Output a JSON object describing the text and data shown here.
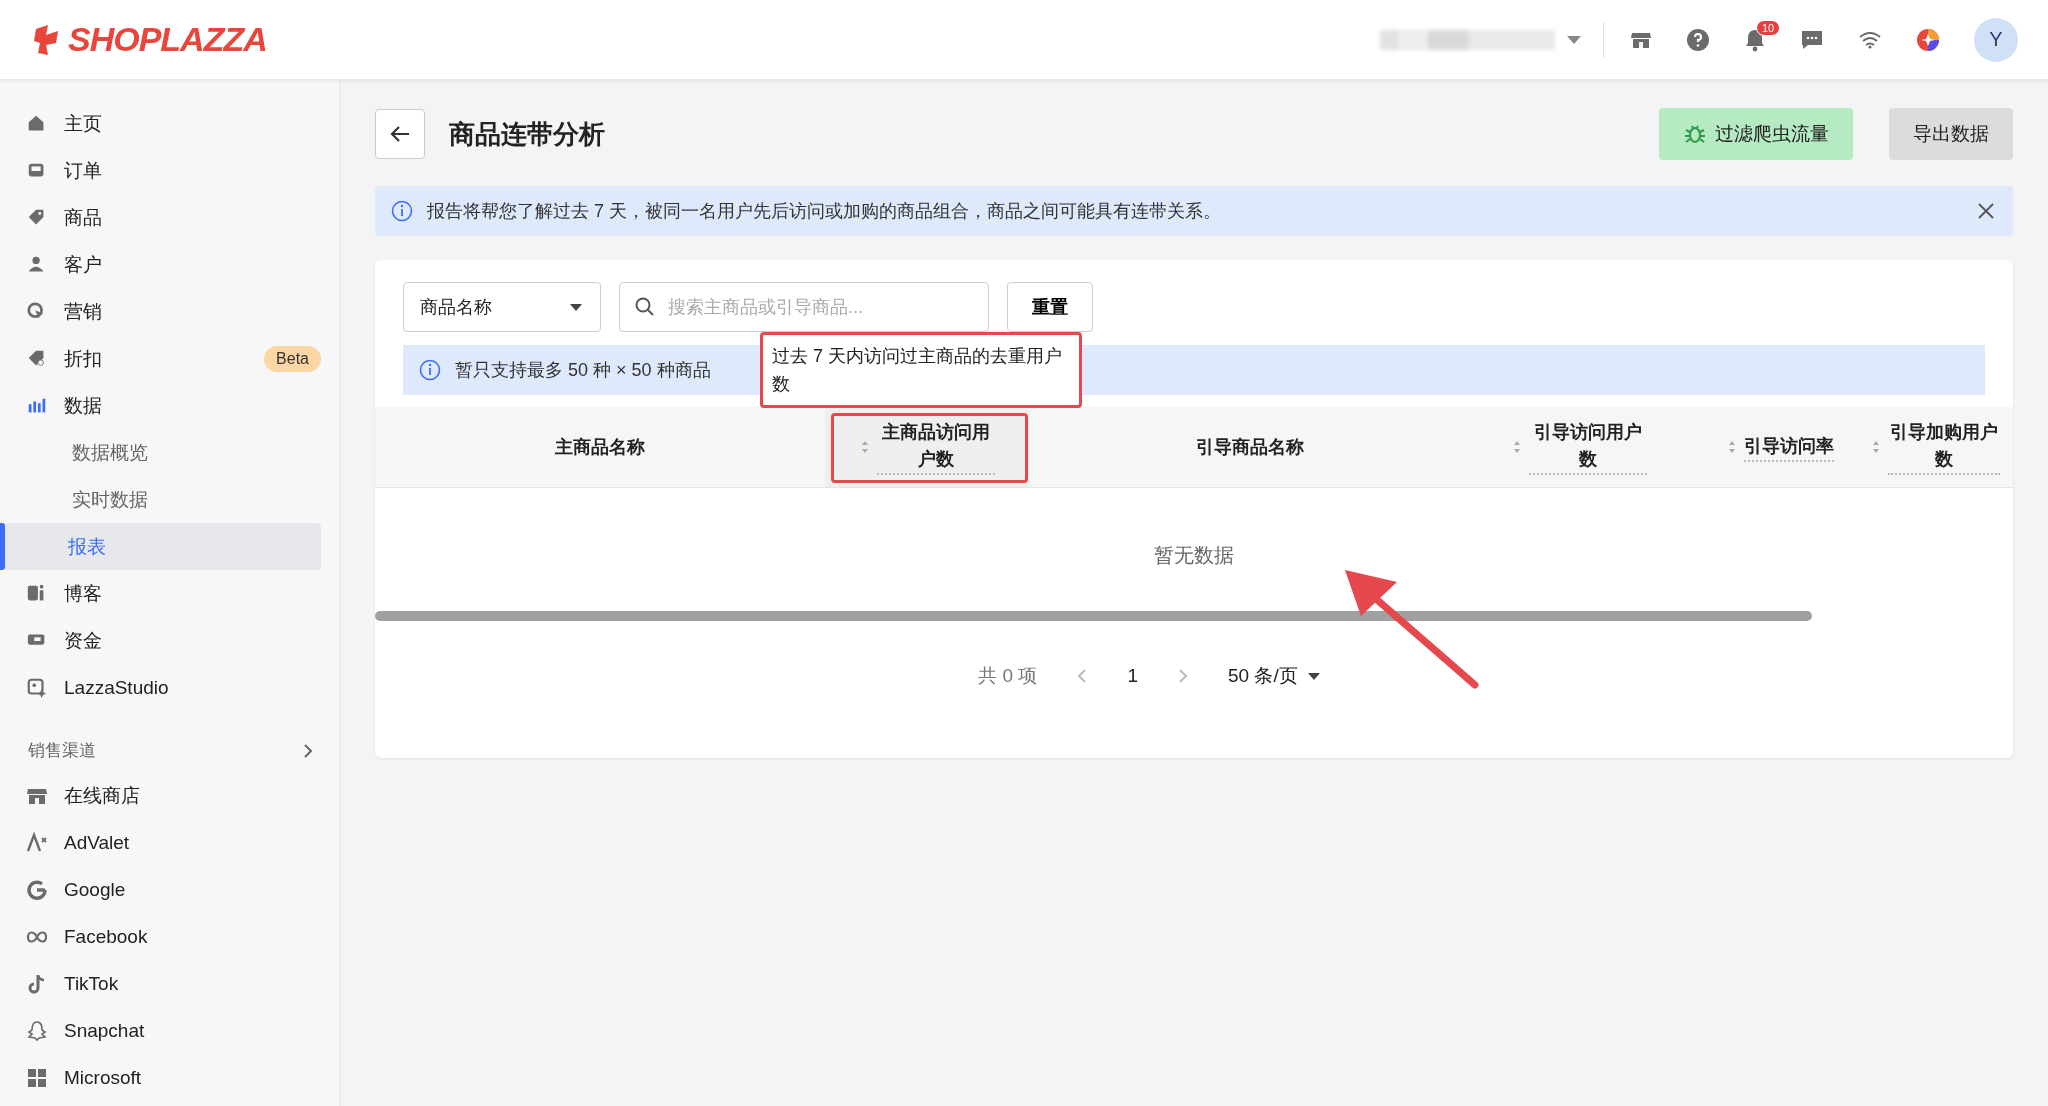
{
  "topbar": {
    "logo": "SHOPLAZZA",
    "notifications_badge": "10",
    "avatar": "Y"
  },
  "sidebar": {
    "items": [
      {
        "label": "主页",
        "selected": false
      },
      {
        "label": "订单",
        "selected": false
      },
      {
        "label": "商品",
        "selected": false
      },
      {
        "label": "客户",
        "selected": false
      },
      {
        "label": "营销",
        "selected": false
      },
      {
        "label": "折扣",
        "selected": false,
        "badge": "Beta"
      },
      {
        "label": "数据",
        "selected": false,
        "children": [
          {
            "label": "数据概览",
            "selected": false
          },
          {
            "label": "实时数据",
            "selected": false
          },
          {
            "label": "报表",
            "selected": true
          }
        ]
      },
      {
        "label": "博客",
        "selected": false
      },
      {
        "label": "资金",
        "selected": false
      },
      {
        "label": "LazzaStudio",
        "selected": false
      }
    ],
    "section": "销售渠道",
    "channels": [
      {
        "label": "在线商店"
      },
      {
        "label": "AdValet"
      },
      {
        "label": "Google"
      },
      {
        "label": "Facebook"
      },
      {
        "label": "TikTok"
      },
      {
        "label": "Snapchat"
      },
      {
        "label": "Microsoft"
      }
    ]
  },
  "page": {
    "title": "商品连带分析",
    "buttons": [
      {
        "label": "过滤爬虫流量",
        "kind": "primary"
      },
      {
        "label": "导出数据",
        "kind": "secondary"
      }
    ],
    "banner": "报告将帮您了解过去 7 天，被同一名用户先后访问或加购的商品组合，商品之间可能具有连带关系。"
  },
  "filters": {
    "select": "商品名称",
    "search_placeholder": "搜索主商品或引导商品...",
    "reset": "重置",
    "notice": "暂只支持最多 50 种 × 50 种商品"
  },
  "tooltip": "过去 7 天内访问过主商品的去重用户数",
  "table": {
    "columns": [
      {
        "label": "主商品名称",
        "sortable": false,
        "highlighted": false
      },
      {
        "label": "主商品访问用户数",
        "sortable": true,
        "highlighted": true
      },
      {
        "label": "引导商品名称",
        "sortable": false,
        "highlighted": false
      },
      {
        "label": "引导访问用户数",
        "sortable": true,
        "highlighted": false
      },
      {
        "label": "引导访问率",
        "sortable": true,
        "highlighted": false
      },
      {
        "label": "引导加购用户数",
        "sortable": true,
        "highlighted": false
      }
    ],
    "empty": "暂无数据"
  },
  "pagination": {
    "total": "共 0 项",
    "page": "1",
    "page_size": "50 条/页"
  }
}
